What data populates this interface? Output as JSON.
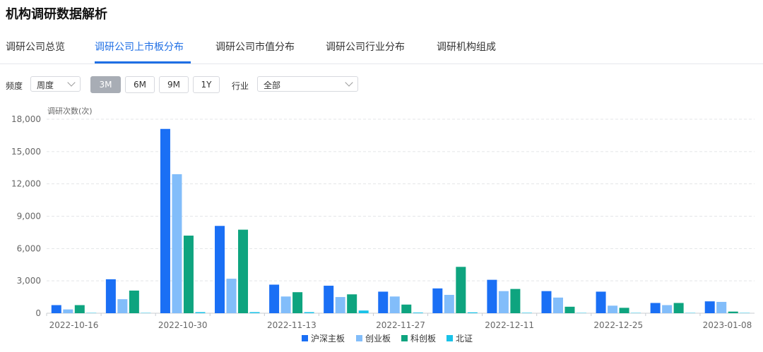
{
  "page_title": "机构调研数据解析",
  "tabs": [
    {
      "label": "调研公司总览",
      "active": false
    },
    {
      "label": "调研公司上市板分布",
      "active": true
    },
    {
      "label": "调研公司市值分布",
      "active": false
    },
    {
      "label": "调研公司行业分布",
      "active": false
    },
    {
      "label": "调研机构组成",
      "active": false
    }
  ],
  "filters": {
    "freq_label": "频度",
    "freq_value": "周度",
    "periods": [
      "3M",
      "6M",
      "9M",
      "1Y"
    ],
    "active_period": "3M",
    "industry_label": "行业",
    "industry_value": "全部"
  },
  "colors": {
    "accent": "#1f6fe5",
    "series": [
      "#1a6ff5",
      "#82bdfa",
      "#0ea47f",
      "#19c2e8"
    ]
  },
  "chart_data": {
    "type": "bar",
    "title": "",
    "ylabel": "调研次数(次)",
    "xlabel": "",
    "ylim": [
      0,
      18000
    ],
    "yticks": [
      0,
      3000,
      6000,
      9000,
      12000,
      15000,
      18000
    ],
    "ytick_labels": [
      "0",
      "3,000",
      "6,000",
      "9,000",
      "12,000",
      "15,000",
      "18,000"
    ],
    "categories": [
      "2022-10-16",
      "2022-10-23",
      "2022-10-30",
      "2022-11-06",
      "2022-11-13",
      "2022-11-20",
      "2022-11-27",
      "2022-12-04",
      "2022-12-11",
      "2022-12-18",
      "2022-12-25",
      "2023-01-01",
      "2023-01-08"
    ],
    "xtick_labels_shown": [
      "2022-10-16",
      "",
      "2022-10-30",
      "",
      "2022-11-13",
      "",
      "2022-11-27",
      "",
      "2022-12-11",
      "",
      "2022-12-25",
      "",
      "2023-01-08"
    ],
    "series": [
      {
        "name": "沪深主板",
        "values": [
          750,
          3150,
          17100,
          8100,
          2650,
          2550,
          2000,
          2300,
          3100,
          2050,
          2000,
          950,
          1100
        ]
      },
      {
        "name": "创业板",
        "values": [
          350,
          1300,
          12900,
          3200,
          1550,
          1500,
          1550,
          1700,
          2050,
          1450,
          700,
          750,
          1050
        ]
      },
      {
        "name": "科创板",
        "values": [
          750,
          2100,
          7200,
          7750,
          1950,
          1750,
          800,
          4300,
          2250,
          600,
          500,
          950,
          150
        ]
      },
      {
        "name": "北证",
        "values": [
          30,
          30,
          100,
          100,
          100,
          250,
          60,
          80,
          40,
          30,
          30,
          30,
          30
        ]
      }
    ],
    "grid": true,
    "legend_position": "bottom-center"
  }
}
